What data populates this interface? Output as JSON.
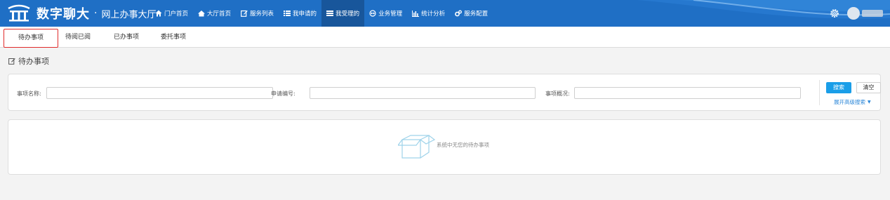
{
  "header": {
    "app_name": "数字聊大",
    "separator": "·",
    "subtitle": "网上办事大厅",
    "nav": [
      {
        "label": "门户首页",
        "icon": "home-icon"
      },
      {
        "label": "大厅首页",
        "icon": "house-icon"
      },
      {
        "label": "服务列表",
        "icon": "edit-icon"
      },
      {
        "label": "我申请的",
        "icon": "list-icon"
      },
      {
        "label": "我受理的",
        "icon": "bars-icon",
        "active": true
      },
      {
        "label": "业务管理",
        "icon": "workflow-icon"
      },
      {
        "label": "统计分析",
        "icon": "chart-icon"
      },
      {
        "label": "服务配置",
        "icon": "gears-icon"
      }
    ],
    "colors": {
      "bar": "#1f6fc5",
      "active": "#18569b"
    }
  },
  "tabs": [
    {
      "label": "待办事项",
      "active": true
    },
    {
      "label": "待阅已阅"
    },
    {
      "label": "已办事项"
    },
    {
      "label": "委托事项"
    }
  ],
  "page_title": "待办事项",
  "search": {
    "item_name_label": "事项名称:",
    "item_name_value": "",
    "apply_no_label": "申请编号:",
    "apply_no_value": "",
    "summary_label": "事项概况:",
    "summary_value": "",
    "search_button": "搜索",
    "clear_button": "清空",
    "advanced_link": "展开高级搜索",
    "advanced_caret": "▼"
  },
  "empty": {
    "message": "系统中无您的待办事项",
    "icon": "empty-box-icon"
  }
}
